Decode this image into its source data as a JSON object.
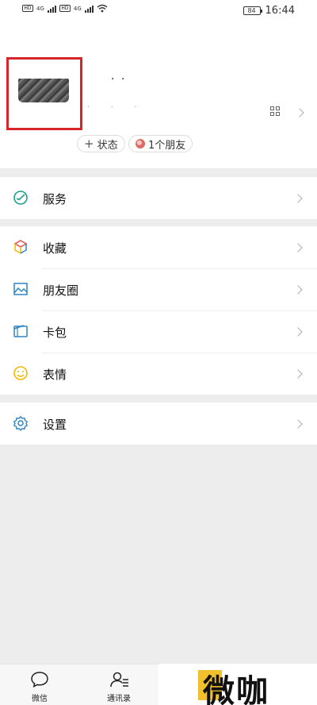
{
  "status_bar": {
    "left": {
      "sim1": "HD",
      "sim2": "HD",
      "net1": "4G",
      "net2": "4G"
    },
    "battery": "84",
    "time": "16:44"
  },
  "profile": {
    "nickname": "· ·",
    "wechat_id": ". . ."
  },
  "pills": {
    "status": "状态",
    "friends": "1个朋友"
  },
  "menu": {
    "services": "服务",
    "favorites": "收藏",
    "moments": "朋友圈",
    "cards": "卡包",
    "stickers": "表情",
    "settings": "设置"
  },
  "tabs": {
    "wechat": "微信",
    "contacts": "通讯录"
  },
  "watermark": "微咖",
  "colors": {
    "highlight": "#d7262a",
    "services_green": "#1a9f8a",
    "moments_blue": "#2f84c5",
    "stickers_yellow": "#f2b900"
  }
}
